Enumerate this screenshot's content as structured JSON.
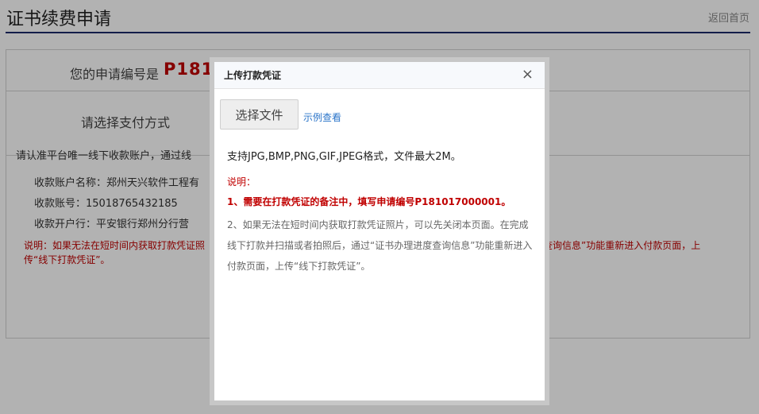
{
  "page": {
    "title": "证书续费申请",
    "back_link": "返回首页",
    "application_label": "您的申请编号是",
    "application_number_visible": "P181",
    "payment_method_label": "请选择支付方式",
    "offline_intro": "请认准平台唯一线下收款账户，通过线",
    "account_name_line": "收款账户名称：郑州天兴软件工程有",
    "account_number_line": "收款账号：15018765432185",
    "bank_line": "收款开户行：平安银行郑州分行营",
    "warning_left": "说明：如果无法在短时间内获取打款凭证照 传“线下打款凭证”。",
    "warning_right": "度查询信息”功能重新进入付款页面，上"
  },
  "modal": {
    "title": "上传打款凭证",
    "close_symbol": "×",
    "choose_file": "选择文件",
    "example_link": "示例查看",
    "formats": "支持JPG,BMP,PNG,GIF,JPEG格式，文件最大2M。",
    "desc_label": "说明：",
    "desc_item_1": "1、需要在打款凭证的备注中，填写申请编号P181017000001。",
    "desc_item_2": "2、如果无法在短时间内获取打款凭证照片，可以先关闭本页面。在完成线下打款并扫描或者拍照后，通过“证书办理进度查询信息”功能重新进入付款页面，上传“线下打款凭证”。"
  },
  "colors": {
    "accent_red": "#c00000",
    "header_rule": "#1c2a6b",
    "link_blue": "#2a74c9"
  }
}
